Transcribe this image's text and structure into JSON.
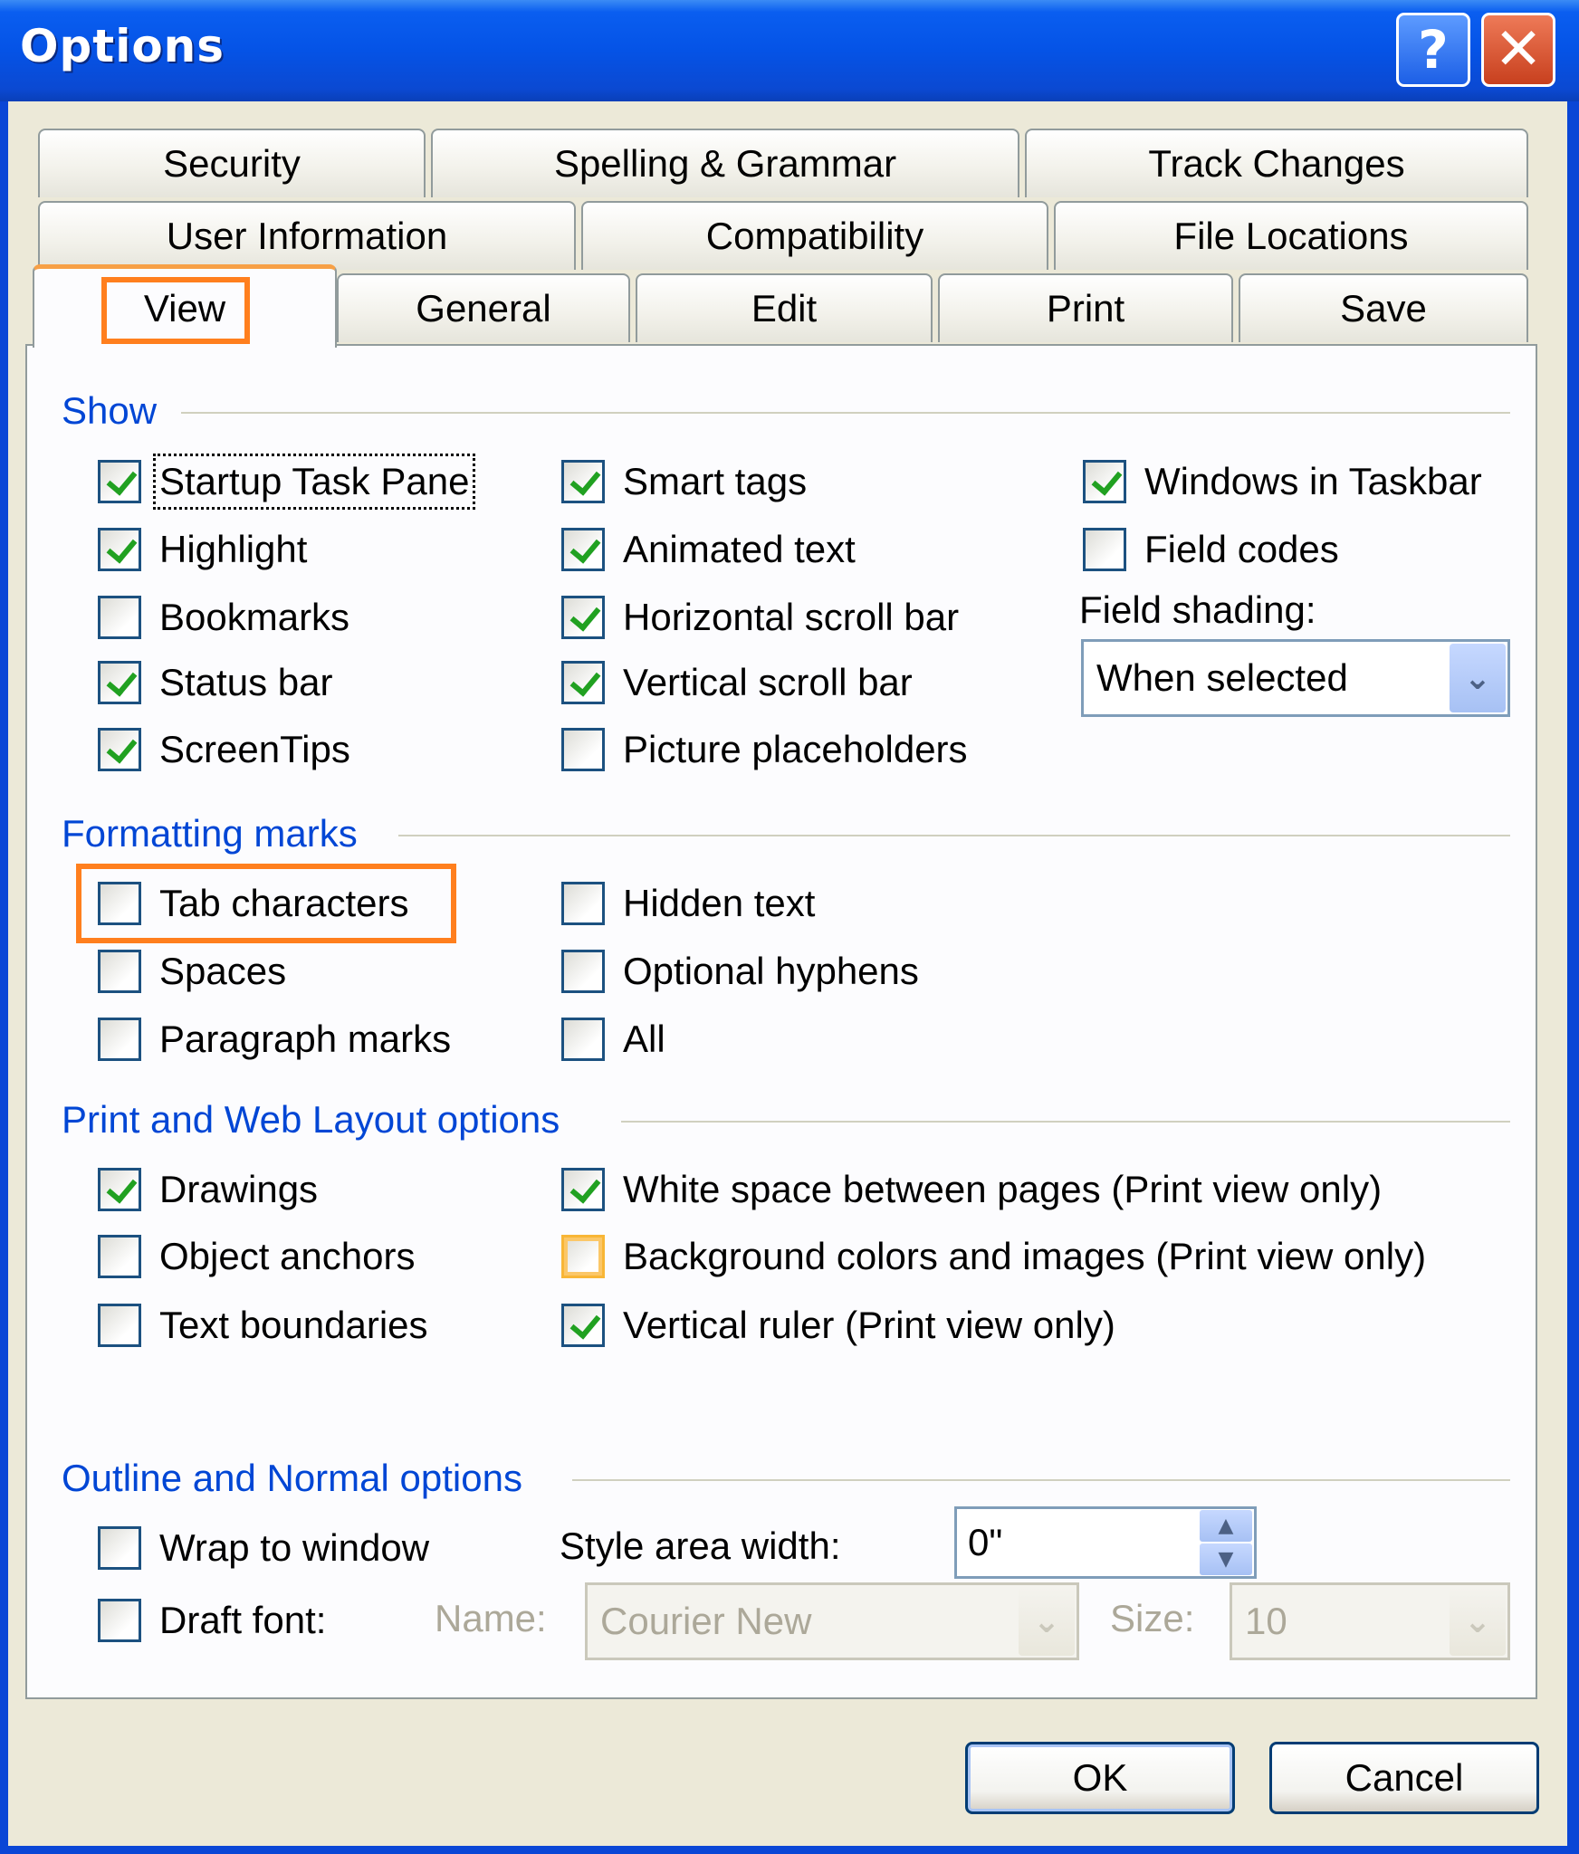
{
  "window": {
    "title": "Options",
    "help_label": "?",
    "close_label": "✕"
  },
  "tabs": {
    "row1": [
      {
        "label": "Security"
      },
      {
        "label": "Spelling & Grammar"
      },
      {
        "label": "Track Changes"
      }
    ],
    "row2": [
      {
        "label": "User Information"
      },
      {
        "label": "Compatibility"
      },
      {
        "label": "File Locations"
      }
    ],
    "row3": [
      {
        "label": "View",
        "active": true
      },
      {
        "label": "General"
      },
      {
        "label": "Edit"
      },
      {
        "label": "Print"
      },
      {
        "label": "Save"
      }
    ]
  },
  "show": {
    "title": "Show",
    "startup_task_pane": {
      "label": "Startup Task Pane",
      "checked": true
    },
    "highlight": {
      "label": "Highlight",
      "checked": true
    },
    "bookmarks": {
      "label": "Bookmarks",
      "checked": false
    },
    "status_bar": {
      "label": "Status bar",
      "checked": true
    },
    "screentips": {
      "label": "ScreenTips",
      "checked": true
    },
    "smart_tags": {
      "label": "Smart tags",
      "checked": true
    },
    "animated_text": {
      "label": "Animated text",
      "checked": true
    },
    "horizontal_scroll_bar": {
      "label": "Horizontal scroll bar",
      "checked": true
    },
    "vertical_scroll_bar": {
      "label": "Vertical scroll bar",
      "checked": true
    },
    "picture_placeholders": {
      "label": "Picture placeholders",
      "checked": false
    },
    "windows_in_taskbar": {
      "label": "Windows in Taskbar",
      "checked": true
    },
    "field_codes": {
      "label": "Field codes",
      "checked": false
    },
    "field_shading_label": "Field shading:",
    "field_shading_value": "When selected"
  },
  "formatting_marks": {
    "title": "Formatting marks",
    "tab_characters": {
      "label": "Tab characters",
      "checked": false
    },
    "spaces": {
      "label": "Spaces",
      "checked": false
    },
    "paragraph_marks": {
      "label": "Paragraph marks",
      "checked": false
    },
    "hidden_text": {
      "label": "Hidden text",
      "checked": false
    },
    "optional_hyphens": {
      "label": "Optional hyphens",
      "checked": false
    },
    "all": {
      "label": "All",
      "checked": false
    }
  },
  "print_web": {
    "title": "Print and Web Layout options",
    "drawings": {
      "label": "Drawings",
      "checked": true
    },
    "object_anchors": {
      "label": "Object anchors",
      "checked": false
    },
    "text_boundaries": {
      "label": "Text boundaries",
      "checked": false
    },
    "white_space": {
      "label": "White space between pages (Print view only)",
      "checked": true
    },
    "background_colors": {
      "label": "Background colors and images (Print view only)",
      "checked": false
    },
    "vertical_ruler": {
      "label": "Vertical ruler (Print view only)",
      "checked": true
    }
  },
  "outline_normal": {
    "title": "Outline and Normal options",
    "wrap_to_window": {
      "label": "Wrap to window",
      "checked": false
    },
    "draft_font": {
      "label": "Draft font:",
      "checked": false
    },
    "style_area_label": "Style area width:",
    "style_area_value": "0\"",
    "name_label": "Name:",
    "name_value": "Courier New",
    "size_label": "Size:",
    "size_value": "10"
  },
  "buttons": {
    "ok": "OK",
    "cancel": "Cancel"
  },
  "colors": {
    "title_bar": "#0553e6",
    "dialog_bg": "#ece9d8",
    "group_title": "#0046d5",
    "highlight": "#ff7f1e",
    "check": "#21a121"
  }
}
